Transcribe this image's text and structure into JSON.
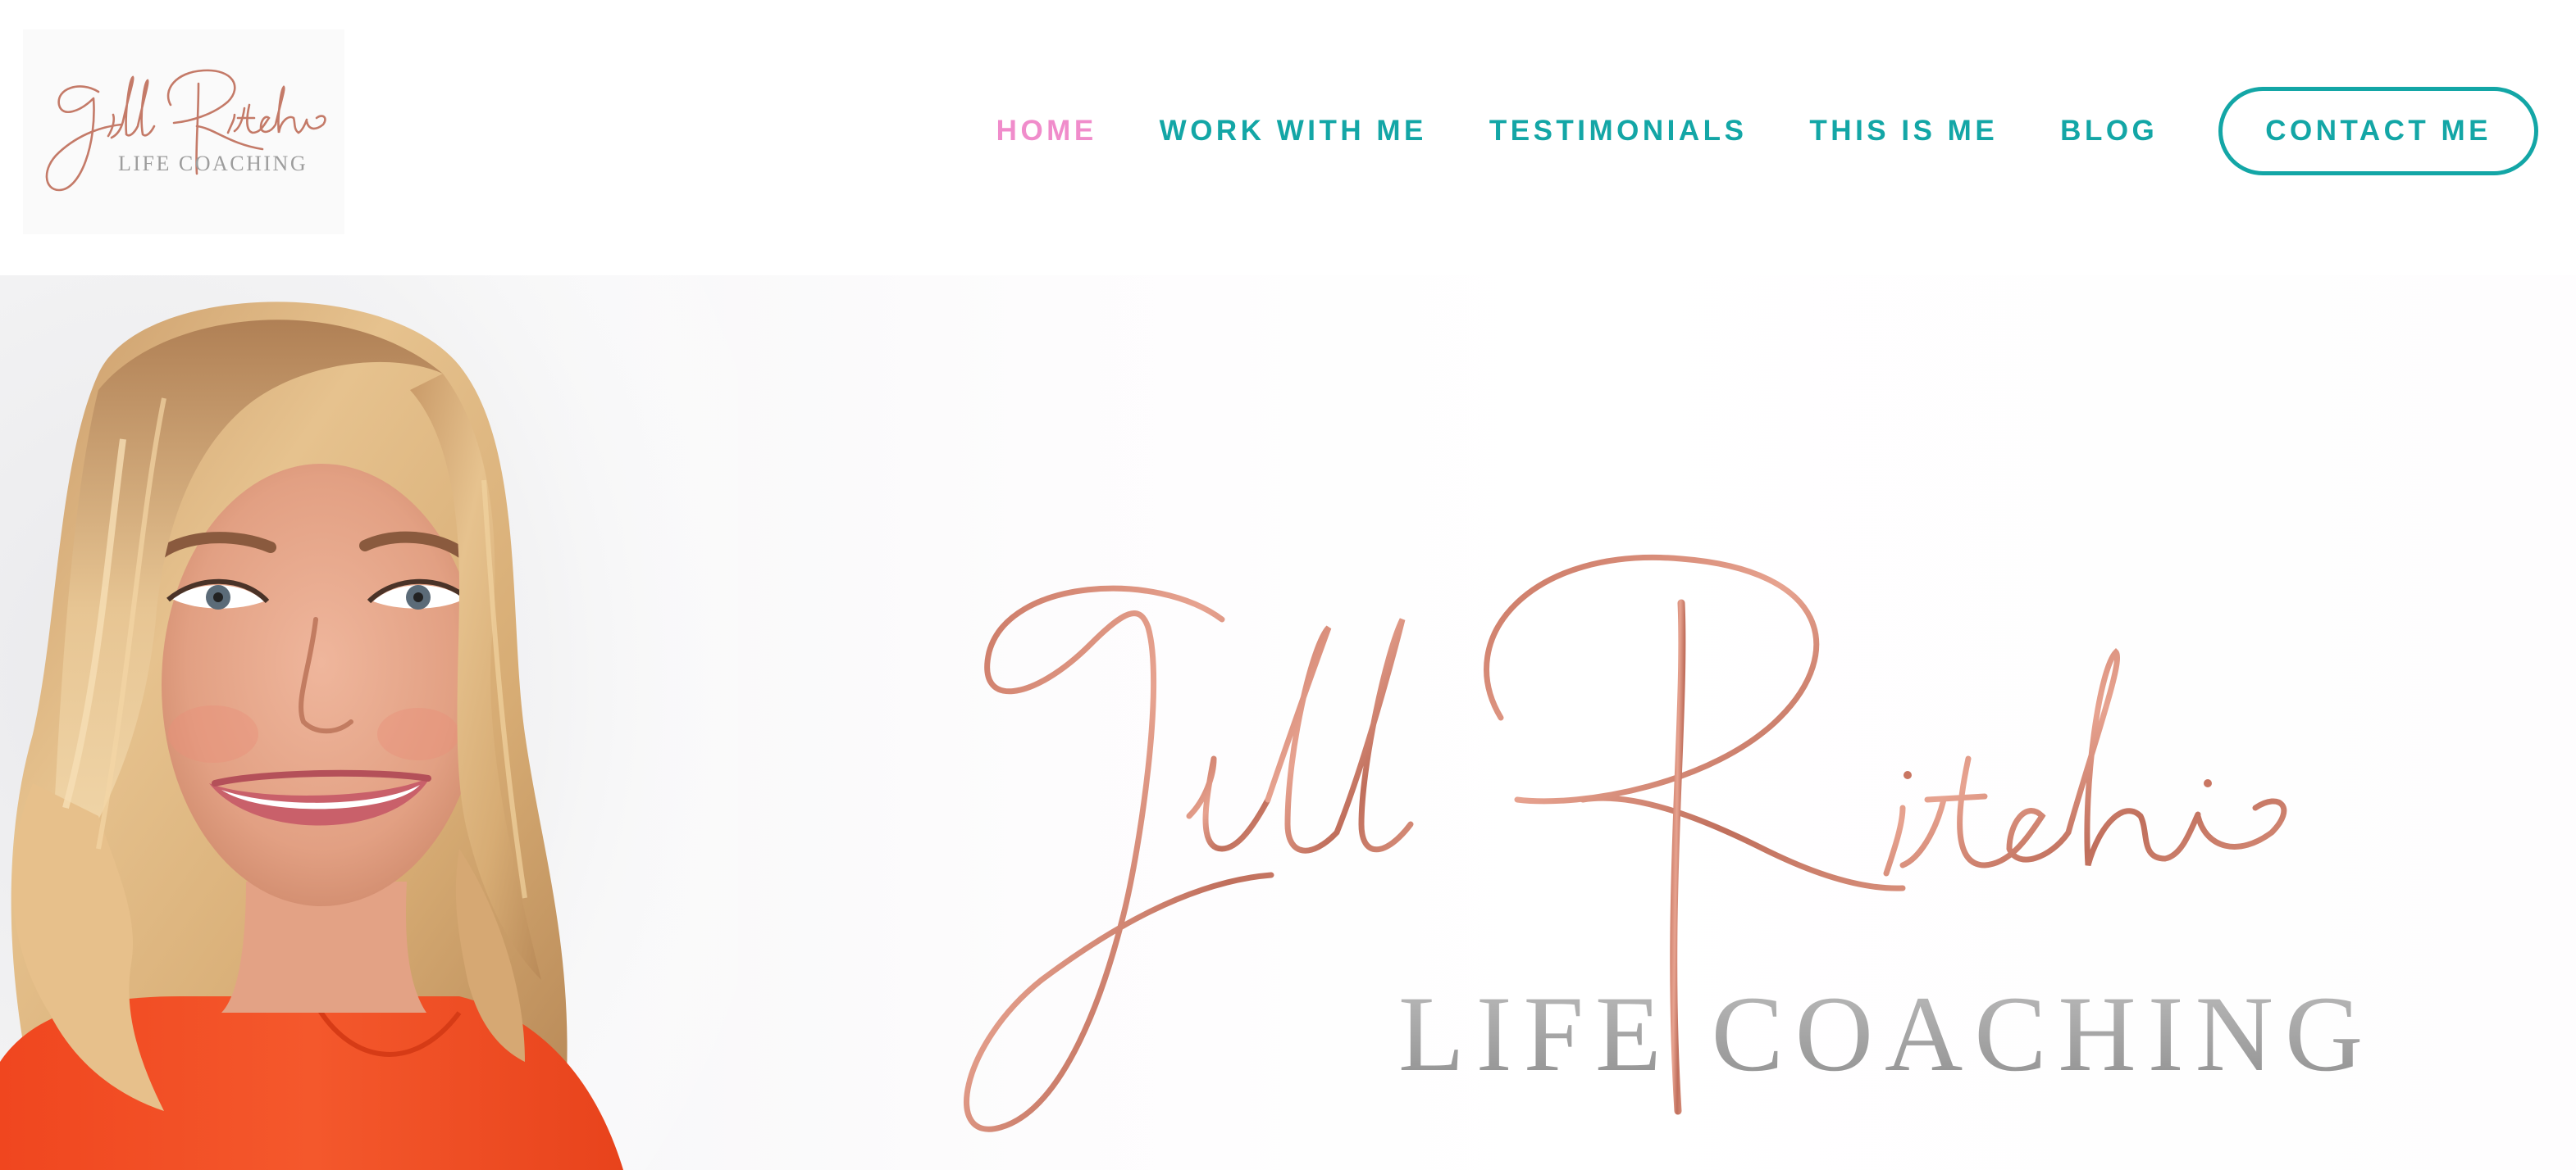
{
  "header": {
    "logo": {
      "script_text": "Jill Ritchie",
      "sub_text": "LIFE COACHING"
    },
    "nav": {
      "items": [
        {
          "label": "HOME",
          "active": true
        },
        {
          "label": "WORK WITH ME",
          "active": false
        },
        {
          "label": "TESTIMONIALS",
          "active": false
        },
        {
          "label": "THIS IS ME",
          "active": false
        },
        {
          "label": "BLOG",
          "active": false
        }
      ],
      "cta_label": "CONTACT ME"
    }
  },
  "hero": {
    "logo": {
      "script_text": "Jill Ritchie",
      "sub_text": "LIFE COACHING"
    },
    "portrait_icon": "woman-portrait-photo"
  },
  "colors": {
    "accent_teal": "#13a6a6",
    "accent_pink": "#f08ccb",
    "rose_gold": "#c47a68",
    "logo_grey": "#a9a9a9"
  }
}
